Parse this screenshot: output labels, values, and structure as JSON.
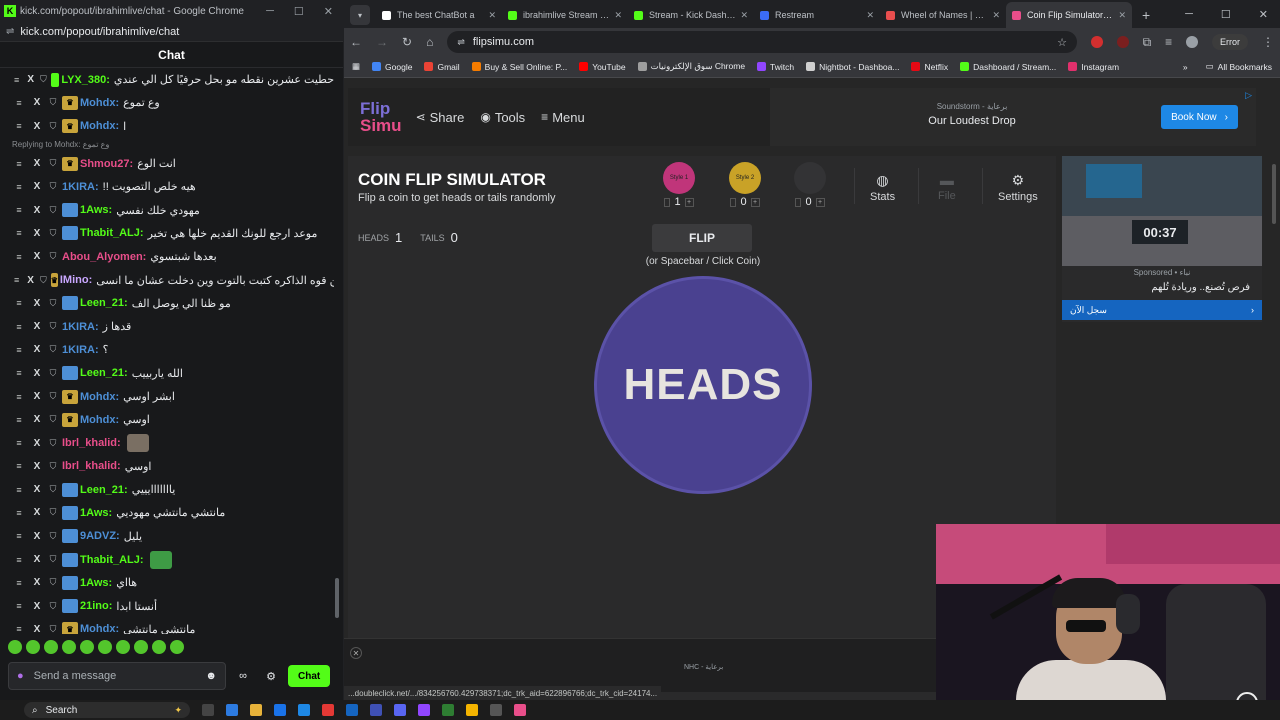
{
  "chat_window": {
    "title": "kick.com/popout/ibrahimlive/chat - Google Chrome",
    "url": "kick.com/popout/ibrahimlive/chat",
    "header": "Chat",
    "messages": [
      {
        "user": "LYX_380:",
        "text": "حطيت عشرين نقطه مو بحل حرفيًا كل الي عندي",
        "user_color": "#53fc18",
        "badge": "green"
      },
      {
        "user": "Mohdx:",
        "text": "وع تموع",
        "user_color": "#4d8fd6",
        "badge": "crown"
      },
      {
        "user": "Mohdx:",
        "text": "ا",
        "user_color": "#4d8fd6",
        "badge": "crown"
      },
      {
        "user": "Shmou27:",
        "text": "انت الوع",
        "user_color": "#e84e8a",
        "badge": "crown",
        "reply": "Replying to Mohdx: وع تموع"
      },
      {
        "user": "1KIRA:",
        "text": "!! هيه خلص التصويت",
        "user_color": "#4d8fd6",
        "badge": ""
      },
      {
        "user": "1Aws:",
        "text": "مهودي خلك نفسي",
        "user_color": "#53fc18",
        "badge": "blue"
      },
      {
        "user": "Thabit_ALJ:",
        "text": "موعد ارجع للونك القديم خلها هي تخير",
        "user_color": "#53fc18",
        "badge": "blue"
      },
      {
        "user": "Abou_Alyomen:",
        "text": "بعدها شبتسوي",
        "user_color": "#e84e8a",
        "badge": ""
      },
      {
        "user": "IMino:",
        "text": "من قوه الذاكره كتبت بالتوت وين دخلت عشان ما انسى",
        "user_color": "#c9a7ff",
        "badge": "crown"
      },
      {
        "user": "Leen_21:",
        "text": "مو ظنا الي يوصل الف",
        "user_color": "#53fc18",
        "badge": "blue"
      },
      {
        "user": "1KIRA:",
        "text": "قدها ز",
        "user_color": "#4d8fd6",
        "badge": ""
      },
      {
        "user": "1KIRA:",
        "text": "؟",
        "user_color": "#4d8fd6",
        "badge": ""
      },
      {
        "user": "Leen_21:",
        "text": "الله ياربييب",
        "user_color": "#53fc18",
        "badge": "blue"
      },
      {
        "user": "Mohdx:",
        "text": "ابشر اوسي",
        "user_color": "#4d8fd6",
        "badge": "crown"
      },
      {
        "user": "Mohdx:",
        "text": "اوسي",
        "user_color": "#4d8fd6",
        "badge": "crown"
      },
      {
        "user": "Ibrl_khalid:",
        "text": "",
        "user_color": "#e84e8a",
        "badge": "",
        "emote": "face"
      },
      {
        "user": "Ibrl_khalid:",
        "text": "اوسي",
        "user_color": "#e84e8a",
        "badge": ""
      },
      {
        "user": "Leen_21:",
        "text": "يااااااايييي",
        "user_color": "#53fc18",
        "badge": "blue"
      },
      {
        "user": "1Aws:",
        "text": "مانتشي مانتشي مهوديي",
        "user_color": "#53fc18",
        "badge": "blue"
      },
      {
        "user": "9ADVZ:",
        "text": "يليل",
        "user_color": "#4d8fd6",
        "badge": "blue"
      },
      {
        "user": "Thabit_ALJ:",
        "text": "",
        "user_color": "#53fc18",
        "badge": "blue",
        "emote": "pepe"
      },
      {
        "user": "1Aws:",
        "text": "هااي",
        "user_color": "#53fc18",
        "badge": "blue"
      },
      {
        "user": "21ino:",
        "text": "أنستا ابدا",
        "user_color": "#53fc18",
        "badge": "blue"
      },
      {
        "user": "Mohdx:",
        "text": "مانتشي مانتشي",
        "user_color": "#4d8fd6",
        "badge": "crown"
      }
    ],
    "input_placeholder": "Send a message",
    "send_label": "Chat"
  },
  "browser": {
    "tabs": [
      {
        "label": "The best ChatBot a",
        "color": "#ffffff",
        "active": false
      },
      {
        "label": "ibrahimlive Stream - W",
        "color": "#53fc18",
        "active": false
      },
      {
        "label": "Stream - Kick Dashbo",
        "color": "#53fc18",
        "active": false
      },
      {
        "label": "Restream",
        "color": "#3b6cf6",
        "active": false
      },
      {
        "label": "Wheel of Names | عجلة",
        "color": "#e84e4e",
        "active": false
      },
      {
        "label": "Coin Flip Simulator - F",
        "color": "#e84e8a",
        "active": true
      }
    ],
    "url": "flipsimu.com",
    "error_label": "Error",
    "bookmarks": [
      {
        "label": "Google",
        "color": "#4285f4"
      },
      {
        "label": "Gmail",
        "color": "#ea4335"
      },
      {
        "label": "Buy & Sell Online: P...",
        "color": "#f57c00"
      },
      {
        "label": "YouTube",
        "color": "#ff0000"
      },
      {
        "label": "سوق الإلكترونيات Chrome",
        "color": "#9e9e9e"
      },
      {
        "label": "Twitch",
        "color": "#9146ff"
      },
      {
        "label": "Nightbot - Dashboa...",
        "color": "#cfcfcf"
      },
      {
        "label": "Netflix",
        "color": "#e50914"
      },
      {
        "label": "Dashboard / Stream...",
        "color": "#53fc18"
      },
      {
        "label": "Instagram",
        "color": "#e1306c"
      }
    ],
    "all_bookmarks": "All Bookmarks"
  },
  "site": {
    "logo_line1": "Flip",
    "logo_line2": "Simu",
    "nav": [
      {
        "label": "Share",
        "icon": "share-icon"
      },
      {
        "label": "Tools",
        "icon": "gamepad-icon"
      },
      {
        "label": "Menu",
        "icon": "hamburger-icon"
      }
    ],
    "top_ad": {
      "sponsor": "Soundstorm  -  برعاية",
      "headline": "Our Loudest Drop",
      "cta": "Book Now"
    },
    "title": "COIN FLIP SIMULATOR",
    "subtitle": "Flip a coin to get heads or tails randomly",
    "styles": [
      {
        "label": "Style 1",
        "count": "1",
        "color": "#c0357a"
      },
      {
        "label": "Style 2",
        "count": "0",
        "color": "#c9a227"
      },
      {
        "label": "",
        "count": "0",
        "color": "#333335"
      }
    ],
    "tools": [
      {
        "label": "Stats",
        "icon": "globe-icon",
        "disabled": false
      },
      {
        "label": "File",
        "icon": "folder-icon",
        "disabled": true
      },
      {
        "label": "Settings",
        "icon": "gear-icon",
        "disabled": false
      }
    ],
    "heads_label": "HEADS",
    "heads_value": "1",
    "tails_label": "TAILS",
    "tails_value": "0",
    "flip_label": "FLIP",
    "flip_hint": "(or Spacebar / Click Coin)",
    "coin_face": "HEADS",
    "side_ad": {
      "timer": "00:37",
      "sponsor": "Sponsored  •  نباء",
      "headline": "فرص تُصنع.. وريادة تُلهم",
      "cta": "سجل الآن"
    },
    "bottom_ad_sponsor": "NHC  -  برعاية",
    "status_url": "...doubleclick.net/.../834256760.429738371;dc_trk_aid=622896766;dc_trk_cid=24174..."
  },
  "taskbar": {
    "search_label": "Search"
  }
}
